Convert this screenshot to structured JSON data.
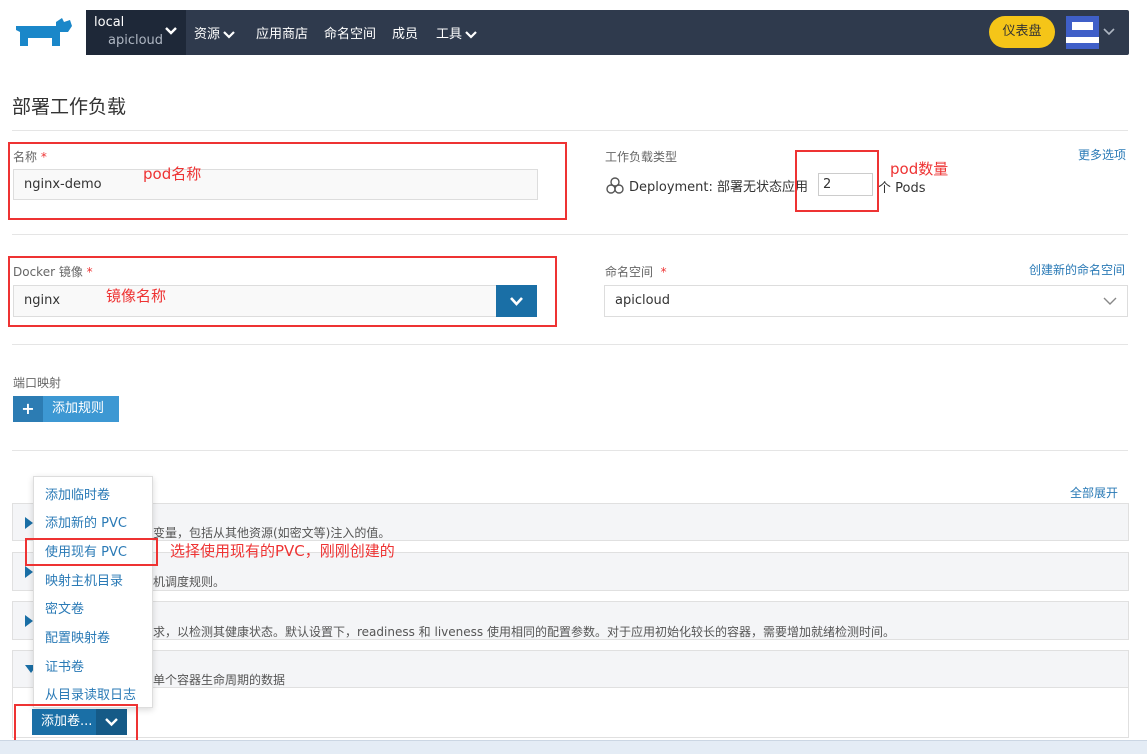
{
  "nav": {
    "cluster_name": "local",
    "project_name": "apicloud",
    "items": [
      {
        "label": "资源",
        "has_dropdown": true
      },
      {
        "label": "应用商店",
        "has_dropdown": false
      },
      {
        "label": "命名空间",
        "has_dropdown": false
      },
      {
        "label": "成员",
        "has_dropdown": false
      },
      {
        "label": "工具",
        "has_dropdown": true
      }
    ],
    "dashboard_label": "仪表盘"
  },
  "page": {
    "title": "部署工作负载"
  },
  "form": {
    "name_label": "名称",
    "required_mark": "*",
    "name_value": "nginx-demo",
    "workload_type_label": "工作负载类型",
    "more_options": "更多选项",
    "deployment_text": "Deployment: 部署无状态应用",
    "scale_value": "2",
    "pods_unit": "个 Pods",
    "image_label": "Docker 镜像",
    "image_value": "nginx",
    "namespace_label": "命名空间",
    "create_namespace": "创建新的命名空间",
    "namespace_value": "apicloud",
    "port_mapping_label": "端口映射",
    "add_rule_label": "添加规则",
    "expand_all": "全部展开"
  },
  "sections": [
    {
      "desc": "变量，包括从其他资源(如密文等)注入的值。"
    },
    {
      "desc": "机调度规则。"
    },
    {
      "desc": "求，以检测其健康状态。默认设置下，readiness 和 liveness 使用相同的配置参数。对于应用初始化较长的容器，需要增加就绪检测时间。"
    },
    {
      "desc": "单个容器生命周期的数据"
    }
  ],
  "volume_menu": {
    "items": [
      "添加临时卷",
      "添加新的 PVC",
      "使用现有 PVC",
      "映射主机目录",
      "密文卷",
      "配置映射卷",
      "证书卷",
      "从目录读取日志"
    ],
    "add_volume_label": "添加卷..."
  },
  "annotations": {
    "pod_name": "pod名称",
    "pod_count": "pod数量",
    "image_name": "镜像名称",
    "use_pvc": "选择使用现有的PVC，刚刚创建的"
  },
  "colors": {
    "nav_bg": "#2f3a4d",
    "accent": "#1a6fa6",
    "dashboard": "#f5c518",
    "annotation": "#ee3333"
  }
}
